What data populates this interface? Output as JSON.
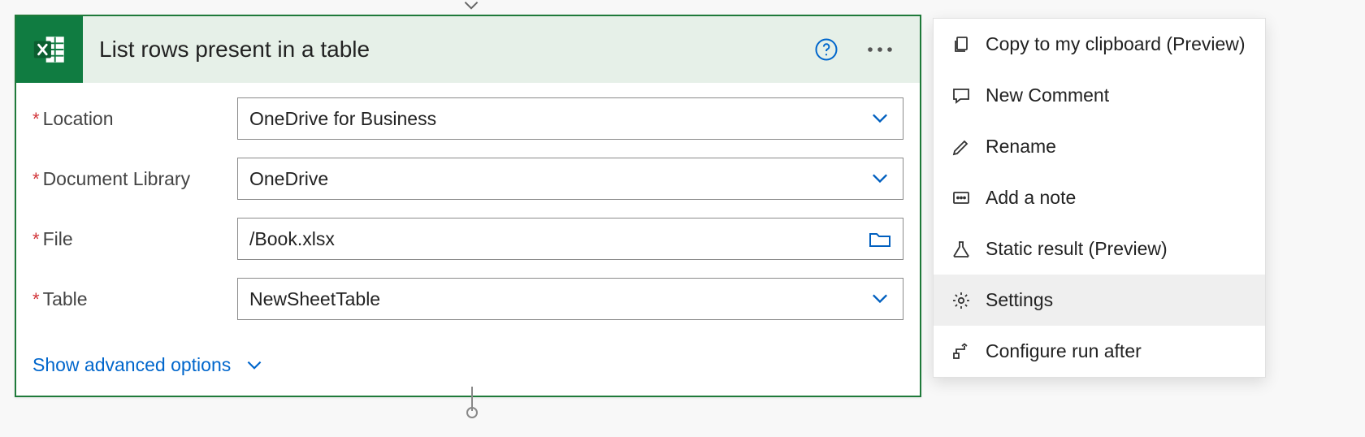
{
  "card": {
    "title": "List rows present in a table",
    "fields": {
      "location": {
        "label": "Location",
        "value": "OneDrive for Business"
      },
      "document_library": {
        "label": "Document Library",
        "value": "OneDrive"
      },
      "file": {
        "label": "File",
        "value": "/Book.xlsx"
      },
      "table": {
        "label": "Table",
        "value": "NewSheetTable"
      }
    },
    "advanced_toggle": "Show advanced options"
  },
  "context_menu": {
    "copy": "Copy to my clipboard (Preview)",
    "new_comment": "New Comment",
    "rename": "Rename",
    "add_note": "Add a note",
    "static_result": "Static result (Preview)",
    "settings": "Settings",
    "configure_run_after": "Configure run after"
  }
}
